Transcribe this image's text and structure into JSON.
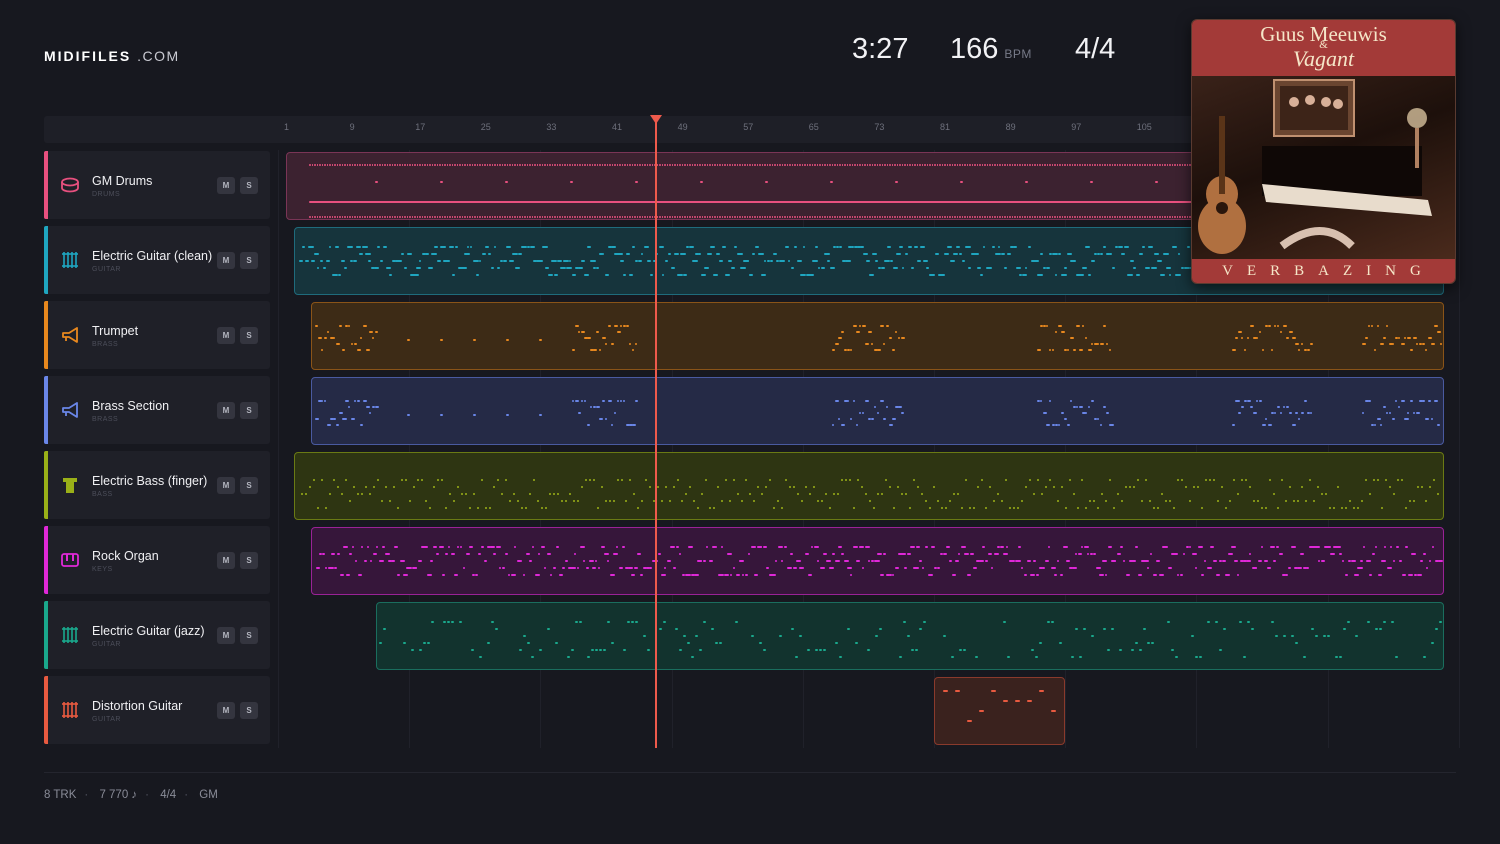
{
  "brand": {
    "name_bold": "MIDIFILES",
    "name_suffix": ".COM"
  },
  "transport": {
    "time": "3:27",
    "bpm": "166",
    "bpm_unit": "BPM",
    "time_signature": "4/4"
  },
  "ruler": {
    "bars": [
      "1",
      "9",
      "17",
      "25",
      "33",
      "41",
      "49",
      "57",
      "65",
      "73",
      "81",
      "89",
      "97",
      "105"
    ]
  },
  "playhead_bar": 45,
  "album": {
    "artist": "Guus Meeuwis",
    "amp": "&",
    "band": "Vagant",
    "title": "VERBAZING"
  },
  "tracks": [
    {
      "name": "GM Drums",
      "category": "DRUMS",
      "color": "#e8507f",
      "icon": "drum-icon"
    },
    {
      "name": "Electric Guitar (clean)",
      "category": "GUITAR",
      "color": "#1fa6c0",
      "icon": "guitar-icon"
    },
    {
      "name": "Trumpet",
      "category": "BRASS",
      "color": "#e8881e",
      "icon": "trumpet-icon"
    },
    {
      "name": "Brass Section",
      "category": "BRASS",
      "color": "#6a86e8",
      "icon": "trumpet-icon"
    },
    {
      "name": "Electric Bass (finger)",
      "category": "BASS",
      "color": "#9ab018",
      "icon": "bass-icon"
    },
    {
      "name": "Rock Organ",
      "category": "KEYS",
      "color": "#e028d8",
      "icon": "keys-icon"
    },
    {
      "name": "Electric Guitar (jazz)",
      "category": "GUITAR",
      "color": "#1aa88c",
      "icon": "guitar-icon"
    },
    {
      "name": "Distortion Guitar",
      "category": "GUITAR",
      "color": "#e85a40",
      "icon": "guitar-icon"
    }
  ],
  "buttons": {
    "mute": "M",
    "solo": "S"
  },
  "footer": {
    "tracks": "8 TRK",
    "notes": "7 770 ♪",
    "meter": "4/4",
    "standard": "GM"
  }
}
